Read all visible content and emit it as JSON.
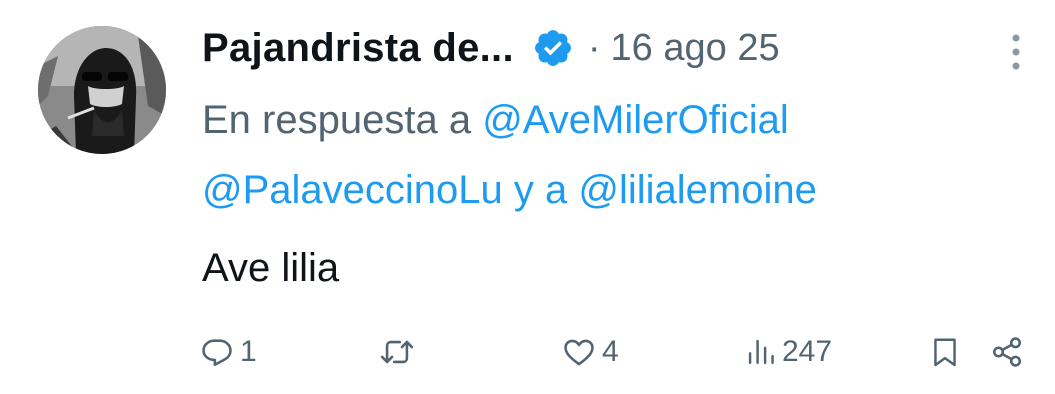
{
  "tweet": {
    "author_name": "Pajandrista de...",
    "separator": "·",
    "date": "16 ago 25",
    "reply_prefix": "En respuesta a",
    "reply_user_1": "@AveMilerOficial",
    "reply_user_2": "@PalaveccinoLu",
    "reply_conjunction": "y a",
    "reply_user_3": "@lilialemoine",
    "text": "Ave lilia"
  },
  "actions": {
    "replies": "1",
    "retweets": "",
    "likes": "4",
    "views": "247"
  },
  "icons": {
    "verified": "verified-badge-icon",
    "more": "more-vertical-icon",
    "reply": "comment-icon",
    "retweet": "retweet-icon",
    "like": "heart-icon",
    "views": "bar-chart-icon",
    "bookmark": "bookmark-icon",
    "share": "share-icon"
  },
  "colors": {
    "text": "#0f1419",
    "secondary": "#536471",
    "link": "#1d9bf0",
    "verified": "#1d9bf0"
  }
}
